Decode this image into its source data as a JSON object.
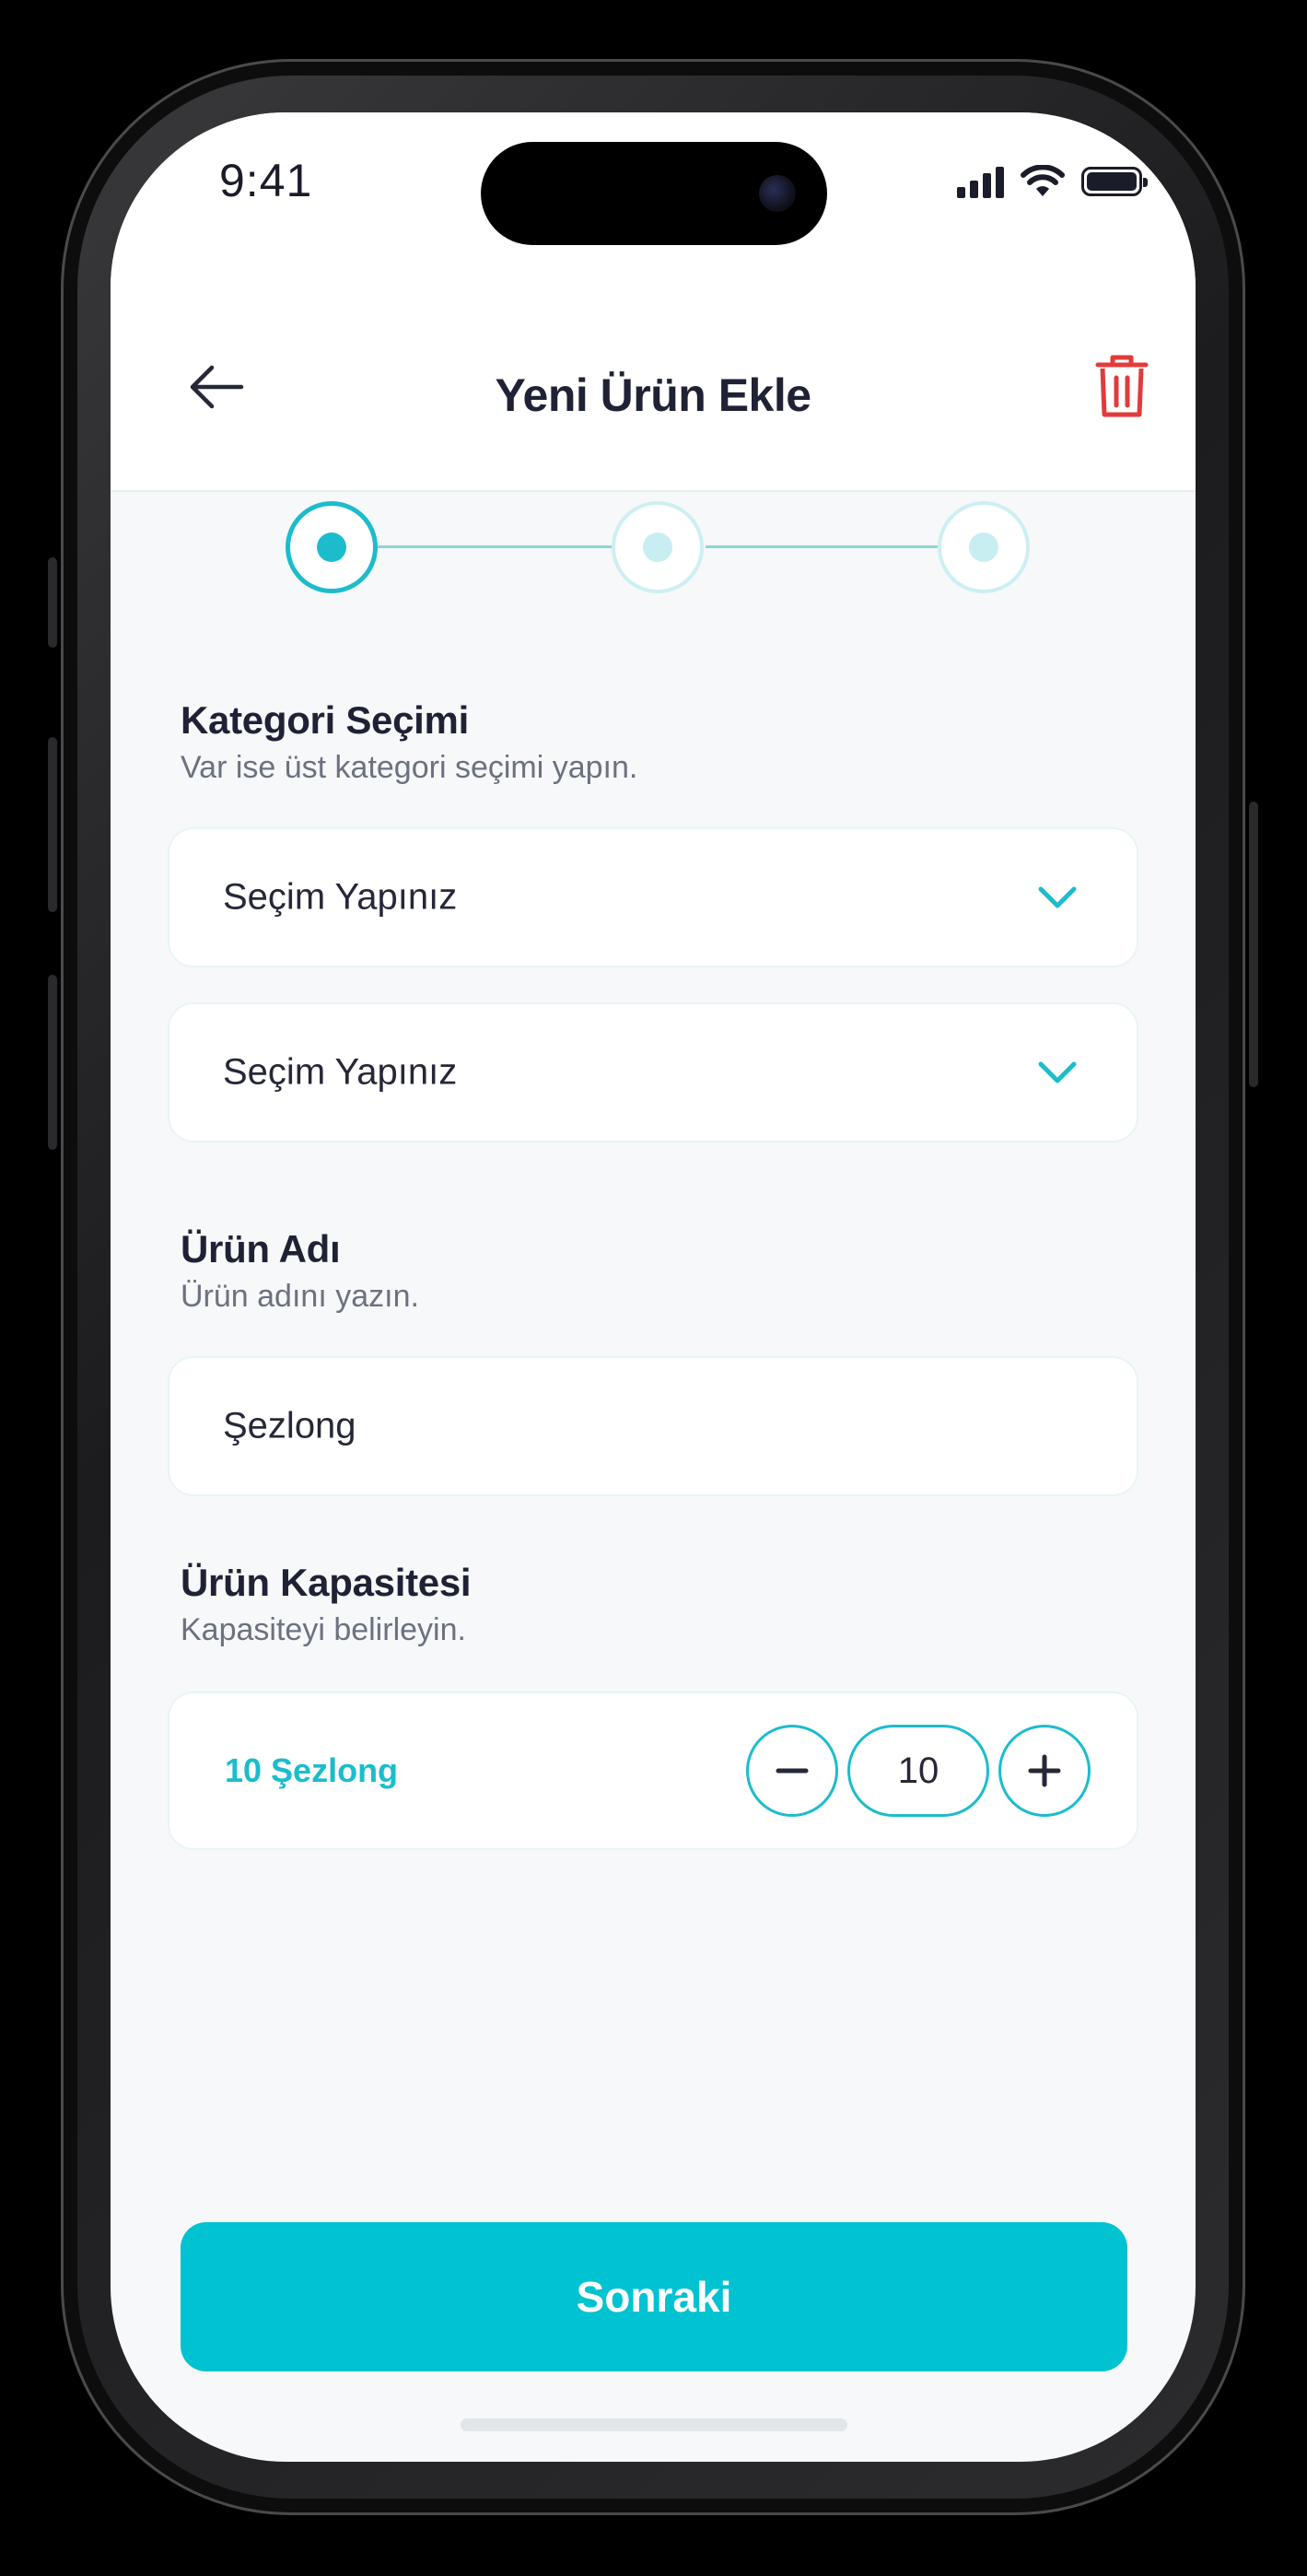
{
  "status_bar": {
    "time": "9:41"
  },
  "header": {
    "title": "Yeni Ürün Ekle",
    "back_icon": "arrow-left-icon",
    "delete_icon": "trash-icon"
  },
  "stepper": {
    "total_steps": 3,
    "current_step": 1,
    "accent": "#1cbccc"
  },
  "category": {
    "title": "Kategori Seçimi",
    "subtitle": "Var ise üst kategori seçimi yapın.",
    "select_1": "Seçim Yapınız",
    "select_2": "Seçim Yapınız"
  },
  "product_name": {
    "title": "Ürün Adı",
    "subtitle": "Ürün adını yazın.",
    "value": "Şezlong"
  },
  "capacity": {
    "title": "Ürün Kapasitesi",
    "subtitle": "Kapasiteyi belirleyin.",
    "label": "10 Şezlong",
    "quantity": "10"
  },
  "actions": {
    "next_label": "Sonraki"
  },
  "colors": {
    "primary": "#00c2d1",
    "danger": "#e23b3b",
    "text": "#1f2235"
  }
}
